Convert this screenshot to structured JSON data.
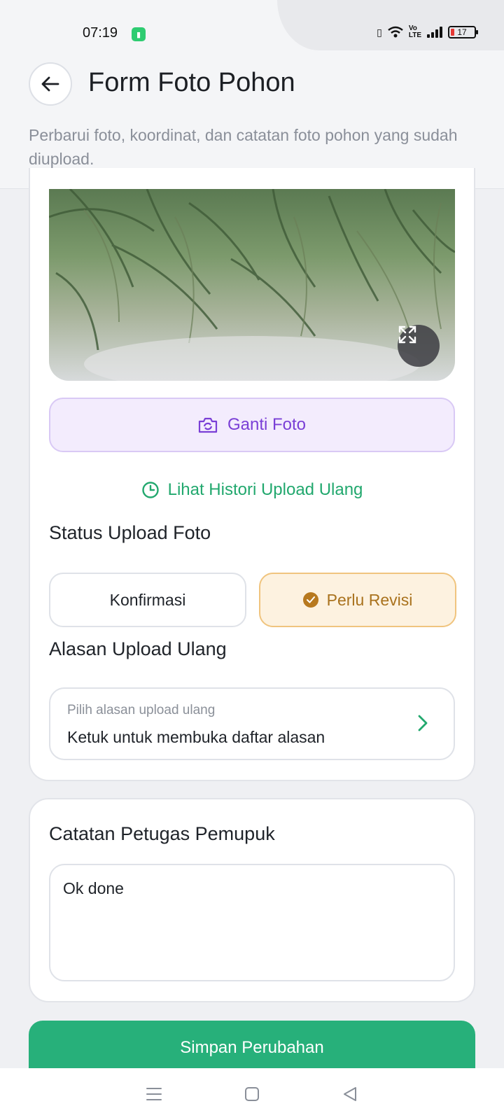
{
  "status_bar": {
    "time": "07:19",
    "battery": "17"
  },
  "header": {
    "title": "Form Foto Pohon",
    "subtitle": "Perbarui foto, koordinat, dan catatan foto pohon yang sudah diupload."
  },
  "photo_section": {
    "change_photo_label": "Ganti Foto",
    "history_link": "Lihat Histori Upload Ulang"
  },
  "status_upload": {
    "label": "Status Upload Foto",
    "options": [
      "Konfirmasi",
      "Perlu Revisi"
    ],
    "selected": "Perlu Revisi"
  },
  "reupload_reason": {
    "label": "Alasan Upload Ulang",
    "placeholder": "Pilih alasan upload ulang",
    "value": "Ketuk untuk membuka daftar alasan"
  },
  "notes": {
    "label": "Catatan Petugas Pemupuk",
    "value": "Ok done"
  },
  "save_button": "Simpan Perubahan",
  "colors": {
    "primary_green": "#27b07a",
    "purple_accent": "#7a3fd6",
    "warning_amber": "#b7791f"
  }
}
